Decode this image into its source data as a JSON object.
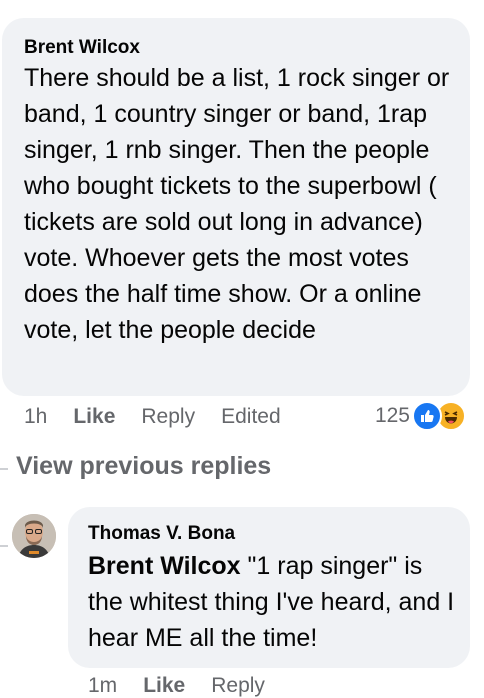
{
  "comment": {
    "author": "Brent Wilcox",
    "text": "There should be a list, 1 rock singer or band, 1 country singer or band, 1rap singer, 1 rnb singer. Then the people who bought tickets to the superbowl ( tickets are sold out long in advance) vote. Whoever gets the most votes does the half time show. Or a online vote, let the people decide",
    "time": "1h",
    "like_label": "Like",
    "reply_label": "Reply",
    "edited_label": "Edited",
    "reaction_count": "125",
    "reaction_icons": [
      "like-icon",
      "haha-icon"
    ]
  },
  "view_previous": "View previous replies",
  "reply": {
    "author": "Thomas V. Bona",
    "mention": "Brent Wilcox",
    "text": " \"1 rap singer\" is the whitest thing I've heard, and I hear ME all the time!",
    "time": "1m",
    "like_label": "Like",
    "reply_label": "Reply"
  },
  "colors": {
    "bubble": "#f0f2f5",
    "meta_text": "#65676b",
    "like_blue": "#1877f2",
    "haha_yellow": "#f7b125"
  }
}
